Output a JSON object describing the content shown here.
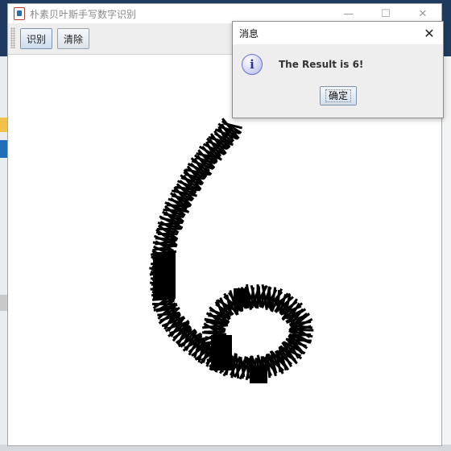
{
  "main_window": {
    "title": "朴素贝叶斯手写数字识别",
    "controls": {
      "minimize": "—",
      "maximize": "☐",
      "close": "✕"
    }
  },
  "toolbar": {
    "recognize_label": "识别",
    "clear_label": "清除"
  },
  "canvas": {
    "stroke_color": "#000000",
    "background": "#ffffff",
    "drawn_digit": "6"
  },
  "dialog": {
    "title": "消息",
    "icon": "info-icon",
    "icon_glyph": "i",
    "message": "The Result is 6!",
    "ok_label": "确定",
    "close_glyph": "✕"
  },
  "colors": {
    "accent": "#7d93ad",
    "desktop_bar": "#1f3a5f"
  }
}
